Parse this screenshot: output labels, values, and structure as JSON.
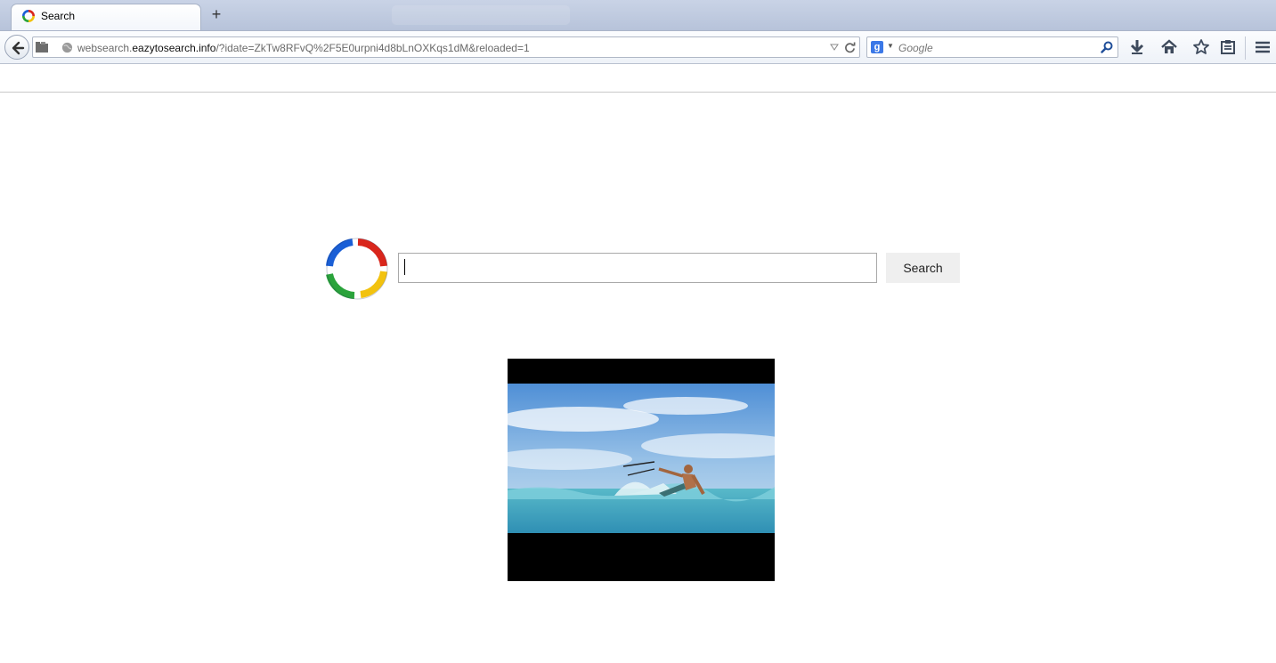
{
  "browser": {
    "tab": {
      "title": "Search"
    },
    "address": {
      "prefix": "websearch.",
      "domain": "eazytosearch.info",
      "path": "/?idate=ZkTw8RFvQ%2F5E0urpni4d8bLnOXKqs1dM&reloaded=1"
    },
    "search_engine": {
      "badge": "g",
      "placeholder": "Google"
    }
  },
  "page": {
    "search_button_label": "Search",
    "search_value": ""
  },
  "colors": {
    "logo_blue": "#1a5fd6",
    "logo_red": "#d9261c",
    "logo_yellow": "#f2c20f",
    "logo_green": "#2aa33b"
  }
}
